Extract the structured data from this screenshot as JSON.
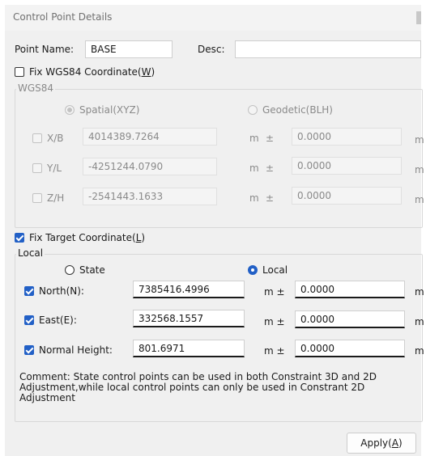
{
  "window": {
    "title": "Control Point Details"
  },
  "point": {
    "name_label": "Point Name:",
    "name_value": "BASE",
    "desc_label": "Desc:",
    "desc_value": ""
  },
  "wgs84": {
    "fix_label": "Fix WGS84 Coordinate(",
    "fix_hotkey": "W",
    "fix_close": ")",
    "fix_checked": false,
    "group_title": "WGS84",
    "mode_spatial": "Spatial(XYZ)",
    "mode_geodetic": "Geodetic(BLH)",
    "selected_mode": "Spatial(XYZ)",
    "rows": [
      {
        "label": "X/B",
        "value": "4014389.7264",
        "unit": "m",
        "pm": "±",
        "sigma": "0.0000",
        "unit2": "m"
      },
      {
        "label": "Y/L",
        "value": "-4251244.0790",
        "unit": "m",
        "pm": "±",
        "sigma": "0.0000",
        "unit2": "m"
      },
      {
        "label": "Z/H",
        "value": "-2541443.1633",
        "unit": "m",
        "pm": "±",
        "sigma": "0.0000",
        "unit2": "m"
      }
    ]
  },
  "target": {
    "fix_label": "Fix Target Coordinate(",
    "fix_hotkey": "L",
    "fix_close": ")",
    "fix_checked": true,
    "group_title": "Local",
    "mode_state": "State",
    "mode_local": "Local",
    "selected_mode": "Local",
    "rows": [
      {
        "label": "North(N):",
        "value": "7385416.4996",
        "unit": "m ±",
        "sigma": "0.0000",
        "unit2": "m",
        "checked": true
      },
      {
        "label": "East(E):",
        "value": "332568.1557",
        "unit": "m ±",
        "sigma": "0.0000",
        "unit2": "m",
        "checked": true
      },
      {
        "label": "Normal Height:",
        "value": "801.6971",
        "unit": "m ±",
        "sigma": "0.0000",
        "unit2": "m",
        "checked": true
      }
    ],
    "comment": "Comment: State control points can be used in both Constraint 3D and 2D Adjustment,while local control points can only be used in Constrant 2D Adjustment"
  },
  "buttons": {
    "apply_label": "Apply(",
    "apply_hotkey": "A",
    "apply_close": ")"
  }
}
